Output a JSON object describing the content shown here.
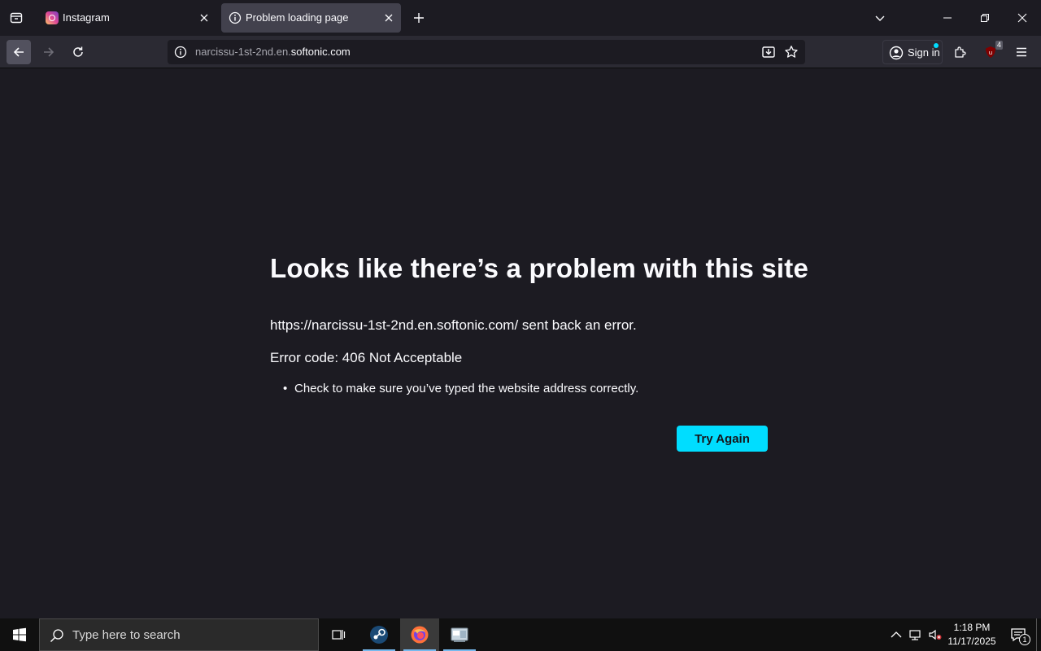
{
  "tabs": [
    {
      "title": "Instagram",
      "active": false
    },
    {
      "title": "Problem loading page",
      "active": true
    }
  ],
  "url": {
    "prefix": "narcissu-1st-2nd.en.",
    "domain": "softonic.com"
  },
  "toolbar": {
    "signin_label": "Sign in",
    "extension_badge": "4"
  },
  "error": {
    "title": "Looks like there’s a problem with this site",
    "description": "https://narcissu-1st-2nd.en.softonic.com/ sent back an error.",
    "code": "Error code: 406 Not Acceptable",
    "suggestions": [
      "Check to make sure you’ve typed the website address correctly."
    ],
    "button_label": "Try Again"
  },
  "taskbar": {
    "search_placeholder": "Type here to search",
    "time": "1:18 PM",
    "date": "11/17/2025",
    "notification_count": "1"
  },
  "colors": {
    "accent": "#00ddff",
    "background": "#1c1b22",
    "toolbar": "#2b2a33"
  }
}
